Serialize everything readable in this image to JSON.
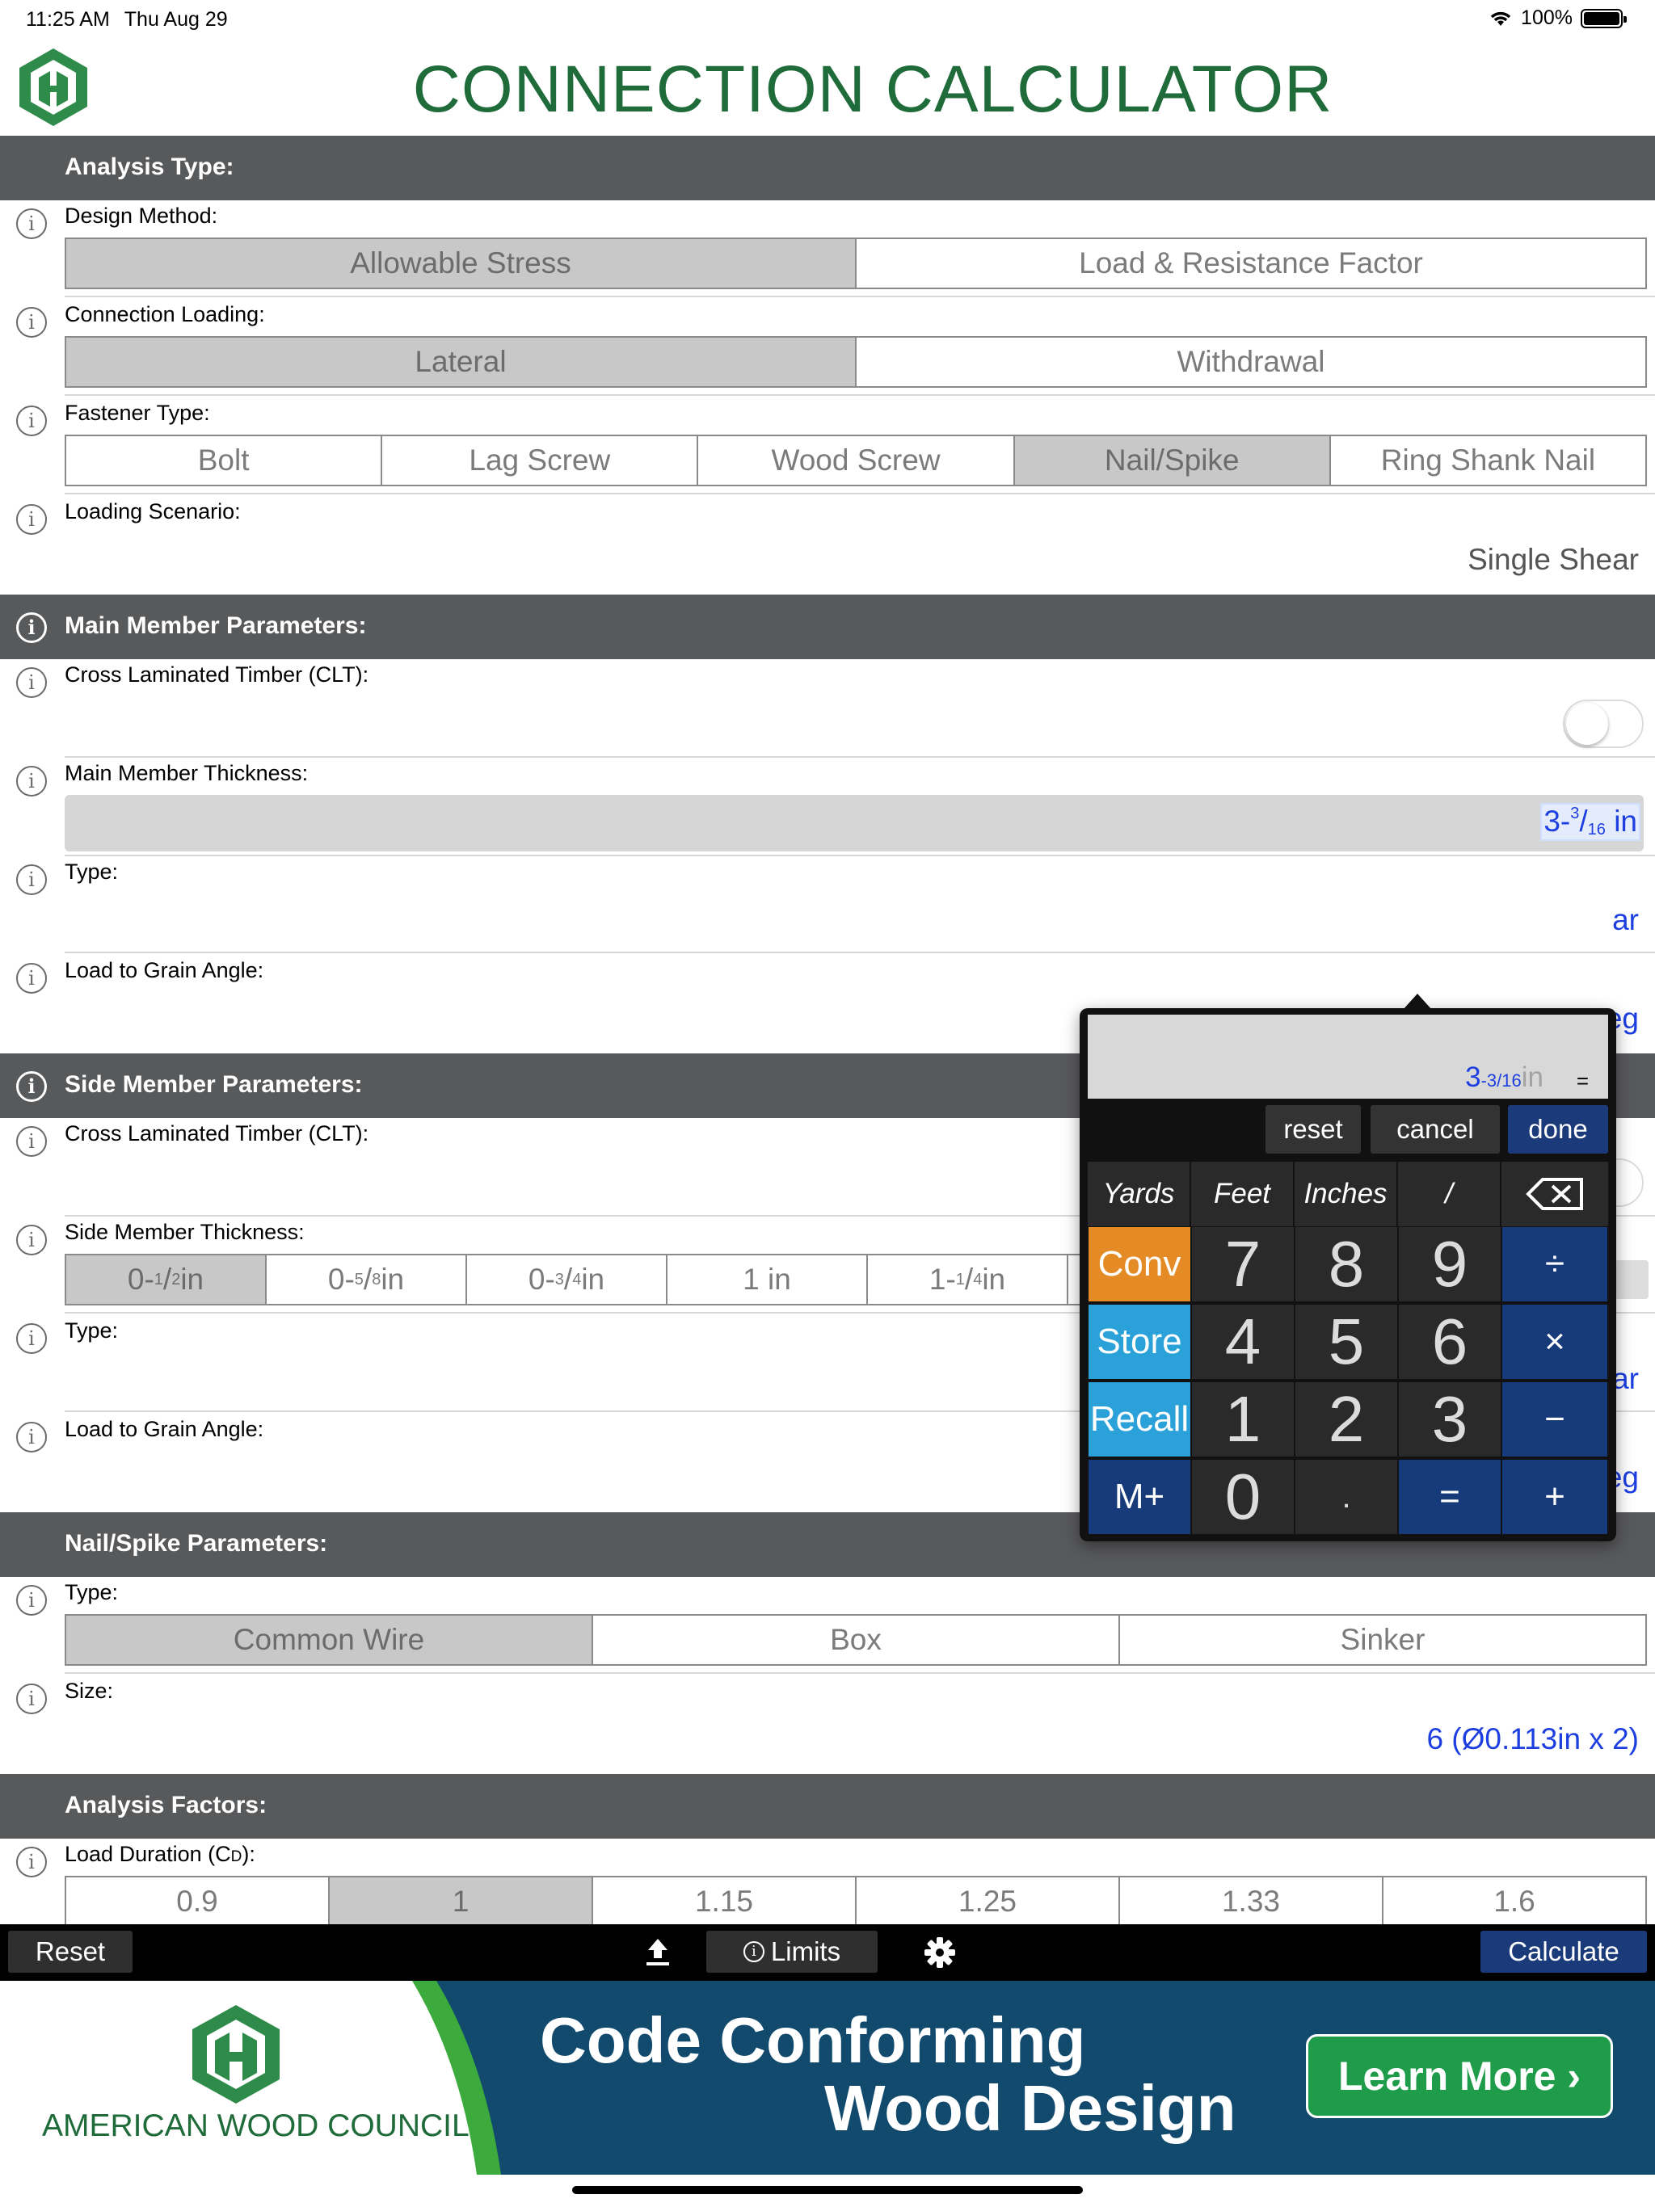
{
  "status_bar": {
    "time": "11:25 AM",
    "date": "Thu Aug 29",
    "battery": "100%"
  },
  "app": {
    "title": "CONNECTION CALCULATOR"
  },
  "colors": {
    "brand_green": "#1f6b3a",
    "section_gray": "#58595b",
    "value_blue": "#1d3fe0",
    "toolbar": "#000000",
    "banner_blue": "#124a6e",
    "learn_green": "#1f9c4a"
  },
  "analysis_type": {
    "header": "Analysis Type:",
    "design_method": {
      "label": "Design Method:",
      "options": [
        "Allowable Stress",
        "Load & Resistance Factor"
      ],
      "selected": 0
    },
    "connection_loading": {
      "label": "Connection Loading:",
      "options": [
        "Lateral",
        "Withdrawal"
      ],
      "selected": 0
    },
    "fastener_type": {
      "label": "Fastener Type:",
      "options": [
        "Bolt",
        "Lag Screw",
        "Wood Screw",
        "Nail/Spike",
        "Ring Shank Nail"
      ],
      "selected": 3
    },
    "loading_scenario": {
      "label": "Loading Scenario:",
      "value": "Single Shear"
    }
  },
  "main_member": {
    "header": "Main Member Parameters:",
    "clt_label": "Cross Laminated Timber (CLT):",
    "clt_on": false,
    "thickness_label": "Main Member Thickness:",
    "thickness": {
      "whole": "3-",
      "num": "3",
      "den": "16",
      "unit": "in"
    },
    "type_label": "Type:",
    "type_value_partial": "ar",
    "angle_label": "Load to Grain Angle:",
    "angle_value_partial": "eg"
  },
  "side_member": {
    "header": "Side Member Parameters:",
    "clt_label": "Cross Laminated Timber (CLT):",
    "thickness_label": "Side Member Thickness:",
    "thickness_options": [
      {
        "whole": "0-",
        "num": "1",
        "den": "2",
        "unit": " in"
      },
      {
        "whole": "0-",
        "num": "5",
        "den": "8",
        "unit": " in"
      },
      {
        "whole": "0-",
        "num": "3",
        "den": "4",
        "unit": " in"
      },
      {
        "whole": "1 in",
        "num": "",
        "den": "",
        "unit": ""
      },
      {
        "whole": "1-",
        "num": "1",
        "den": "4",
        "unit": " in"
      }
    ],
    "thickness_selected": 0,
    "type_label": "Type:",
    "type_value_partial": "ar",
    "angle_label": "Load to Grain Angle:",
    "angle_value": "0 deg"
  },
  "nail_params": {
    "header": "Nail/Spike Parameters:",
    "type_label": "Type:",
    "type_options": [
      "Common Wire",
      "Box",
      "Sinker"
    ],
    "type_selected": 0,
    "size_label": "Size:",
    "size_value": "6 (Ø0.113in x 2)"
  },
  "analysis_factors": {
    "header": "Analysis Factors:",
    "load_duration_label": "Load Duration (C",
    "load_duration_sub": "D",
    "load_duration_suffix": "):",
    "options": [
      "0.9",
      "1",
      "1.15",
      "1.25",
      "1.33",
      "1.6"
    ],
    "selected": 1
  },
  "calculator": {
    "display_whole": "3",
    "display_frac": "-3/16",
    "display_unit": "in",
    "display_eq": "=",
    "buttons": {
      "reset": "reset",
      "cancel": "cancel",
      "done": "done"
    },
    "units": [
      "Yards",
      "Feet",
      "Inches",
      "/"
    ],
    "keys": {
      "conv": "Conv",
      "store": "Store",
      "recall": "Recall",
      "mplus": "M+",
      "n7": "7",
      "n8": "8",
      "n9": "9",
      "n4": "4",
      "n5": "5",
      "n6": "6",
      "n1": "1",
      "n2": "2",
      "n3": "3",
      "n0": "0",
      "dot": ".",
      "div": "÷",
      "mul": "×",
      "sub": "−",
      "eq": "=",
      "add": "+"
    }
  },
  "toolbar": {
    "reset": "Reset",
    "limits": "Limits",
    "calculate": "Calculate"
  },
  "banner": {
    "brand": "AMERICAN WOOD COUNCIL",
    "headline1": "Code Conforming",
    "headline2": "Wood Design",
    "cta": "Learn More ›"
  }
}
